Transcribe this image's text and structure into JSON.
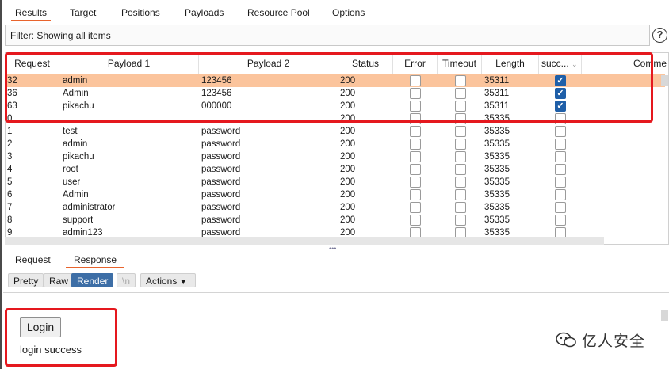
{
  "tabs": [
    "Results",
    "Target",
    "Positions",
    "Payloads",
    "Resource Pool",
    "Options"
  ],
  "filter": {
    "text": "Filter: Showing all items"
  },
  "help_icon": "?",
  "columns": [
    "Request",
    "Payload 1",
    "Payload 2",
    "Status",
    "Error",
    "Timeout",
    "Length",
    "succ...",
    "Comme"
  ],
  "rows": [
    {
      "request": "32",
      "payload1": "admin",
      "payload2": "123456",
      "status": "200",
      "error": false,
      "timeout": false,
      "length": "35311",
      "success": true,
      "selected": true
    },
    {
      "request": "36",
      "payload1": "Admin",
      "payload2": "123456",
      "status": "200",
      "error": false,
      "timeout": false,
      "length": "35311",
      "success": true,
      "selected": false
    },
    {
      "request": "63",
      "payload1": "pikachu",
      "payload2": "000000",
      "status": "200",
      "error": false,
      "timeout": false,
      "length": "35311",
      "success": true,
      "selected": false
    },
    {
      "request": "0",
      "payload1": "",
      "payload2": "",
      "status": "200",
      "error": false,
      "timeout": false,
      "length": "35335",
      "success": false,
      "selected": false
    },
    {
      "request": "1",
      "payload1": "test",
      "payload2": "password",
      "status": "200",
      "error": false,
      "timeout": false,
      "length": "35335",
      "success": false,
      "selected": false
    },
    {
      "request": "2",
      "payload1": "admin",
      "payload2": "password",
      "status": "200",
      "error": false,
      "timeout": false,
      "length": "35335",
      "success": false,
      "selected": false
    },
    {
      "request": "3",
      "payload1": "pikachu",
      "payload2": "password",
      "status": "200",
      "error": false,
      "timeout": false,
      "length": "35335",
      "success": false,
      "selected": false
    },
    {
      "request": "4",
      "payload1": "root",
      "payload2": "password",
      "status": "200",
      "error": false,
      "timeout": false,
      "length": "35335",
      "success": false,
      "selected": false
    },
    {
      "request": "5",
      "payload1": "user",
      "payload2": "password",
      "status": "200",
      "error": false,
      "timeout": false,
      "length": "35335",
      "success": false,
      "selected": false
    },
    {
      "request": "6",
      "payload1": "Admin",
      "payload2": "password",
      "status": "200",
      "error": false,
      "timeout": false,
      "length": "35335",
      "success": false,
      "selected": false
    },
    {
      "request": "7",
      "payload1": "administrator",
      "payload2": "password",
      "status": "200",
      "error": false,
      "timeout": false,
      "length": "35335",
      "success": false,
      "selected": false
    },
    {
      "request": "8",
      "payload1": "support",
      "payload2": "password",
      "status": "200",
      "error": false,
      "timeout": false,
      "length": "35335",
      "success": false,
      "selected": false
    },
    {
      "request": "9",
      "payload1": "admin123",
      "payload2": "password",
      "status": "200",
      "error": false,
      "timeout": false,
      "length": "35335",
      "success": false,
      "selected": false
    }
  ],
  "subtabs": [
    "Request",
    "Response"
  ],
  "toolbar": {
    "pretty": "Pretty",
    "raw": "Raw",
    "render": "Render",
    "newline": "\\n",
    "actions": "Actions"
  },
  "render": {
    "login_button": "Login",
    "message": "login success"
  },
  "watermark": {
    "text": "亿人安全"
  },
  "colors": {
    "accent": "#e8642d",
    "selected_row": "#fbc49c",
    "highlight_box": "#e5181e",
    "render_active": "#3d6ea6"
  }
}
